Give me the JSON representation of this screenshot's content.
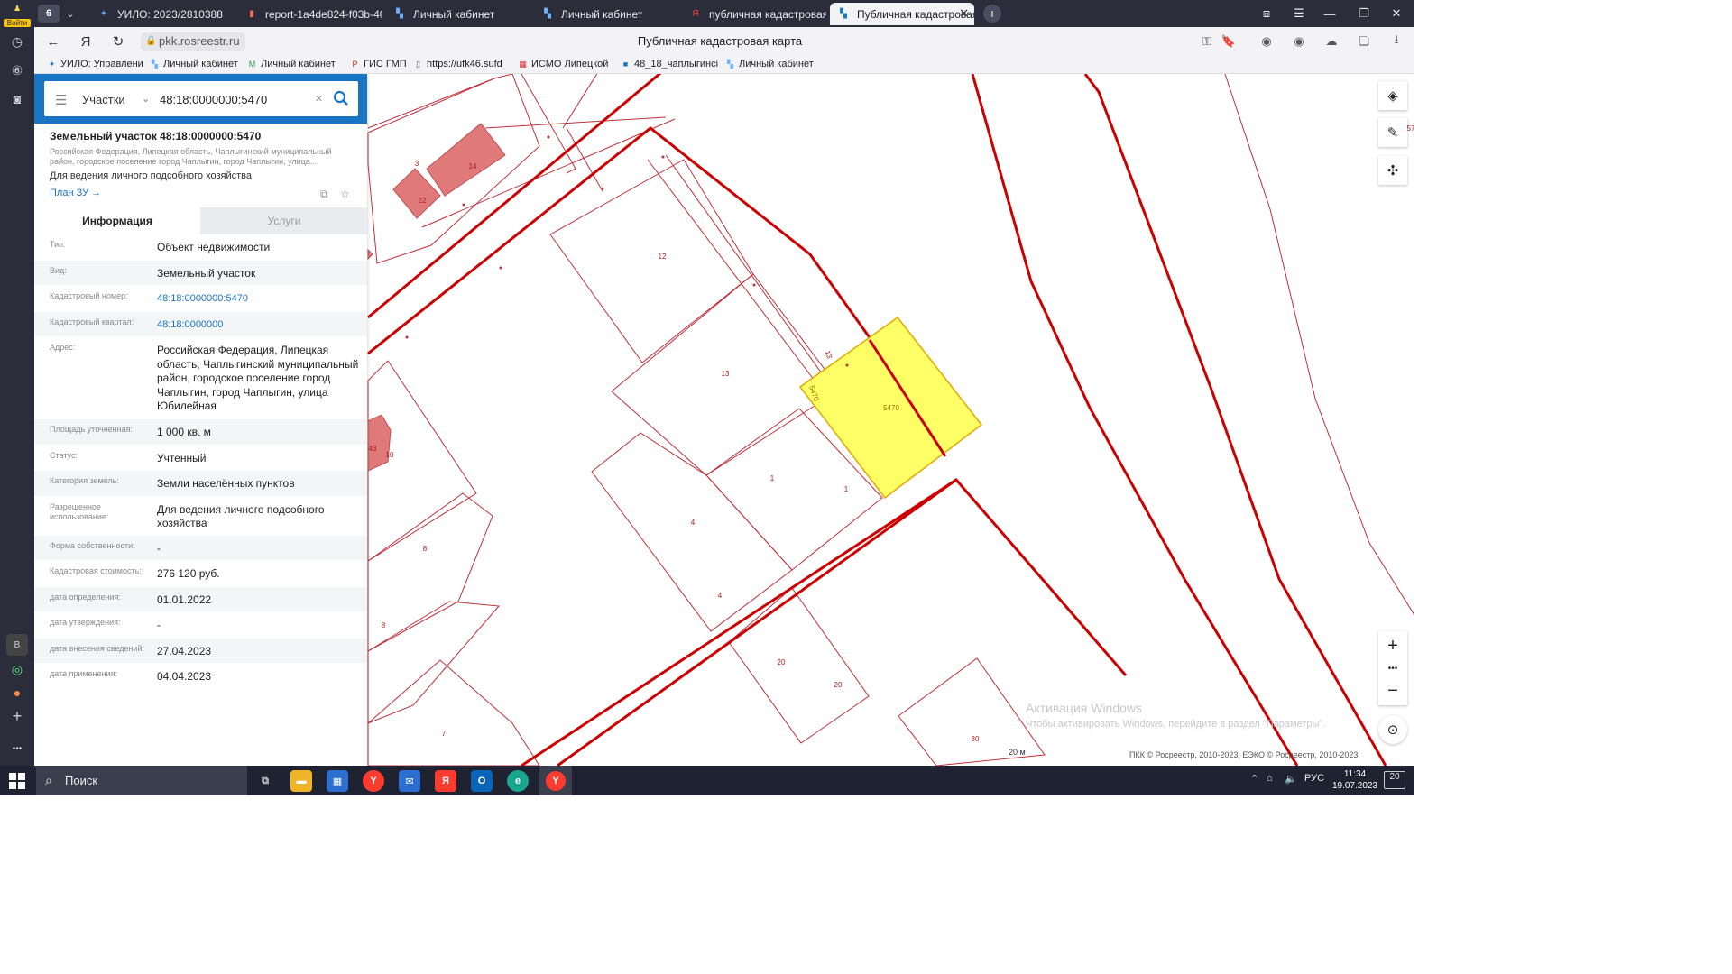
{
  "browser": {
    "tab_count": "6",
    "login_label": "Войти",
    "tabs": [
      {
        "label": "УИЛО: 2023/2810388",
        "active": false
      },
      {
        "label": "report-1a4de824-f03b-40e",
        "active": false
      },
      {
        "label": "Личный кабинет",
        "active": false
      },
      {
        "label": "Личный кабинет",
        "active": false
      },
      {
        "label": "публичная кадастровая к",
        "active": false
      },
      {
        "label": "Публичная кадастровая",
        "active": true
      }
    ],
    "url": "pkk.rosreestr.ru",
    "page_title": "Публичная кадастровая карта",
    "bookmarks": [
      "УИЛО: Управлени",
      "Личный кабинет",
      "Личный кабинет",
      "ГИС ГМП",
      "https://ufk46.sufd",
      "ИСМО Липецкой",
      "48_18_чаплыгинсі",
      "Личный кабинет"
    ],
    "sidebar_items": [
      "history-icon",
      "tabs-icon",
      "camera-icon"
    ]
  },
  "search": {
    "type_label": "Участки",
    "query": "48:18:0000000:5470"
  },
  "object": {
    "title": "Земельный участок 48:18:0000000:5470",
    "address_short": "Российская Федерация, Липецкая область, Чаплыгинский муниципальный район, городское поселение город Чаплыгин, город Чаплыгин, улица...",
    "use": "Для ведения личного подсобного хозяйства",
    "plan_link": "План ЗУ →"
  },
  "panel_tabs": [
    "Информация",
    "Услуги"
  ],
  "info_rows": [
    {
      "key": "Тип:",
      "value": "Объект недвижимости"
    },
    {
      "key": "Вид:",
      "value": "Земельный участок"
    },
    {
      "key": "Кадастровый номер:",
      "value": "48:18:0000000:5470",
      "link": true
    },
    {
      "key": "Кадастровый квартал:",
      "value": "48:18:0000000",
      "link": true
    },
    {
      "key": "Адрес:",
      "value": "Российская Федерация, Липецкая область, Чаплыгинский муниципальный район, городское поселение город Чаплыгин, город Чаплыгин, улица Юбилейная"
    },
    {
      "key": "Площадь уточненная:",
      "value": "1 000 кв. м"
    },
    {
      "key": "Статус:",
      "value": "Учтенный"
    },
    {
      "key": "Категория земель:",
      "value": "Земли населённых пунктов"
    },
    {
      "key": "Разрешенное использование:",
      "value": "Для ведения личного подсобного хозяйства"
    },
    {
      "key": "Форма собственности:",
      "value": "-"
    },
    {
      "key": "Кадастровая стоимость:",
      "value": "276 120 руб."
    },
    {
      "key": "дата определения:",
      "value": "01.01.2022"
    },
    {
      "key": "дата утверждения:",
      "value": "-"
    },
    {
      "key": "дата внесения сведений:",
      "value": "27.04.2023"
    },
    {
      "key": "дата применения:",
      "value": "04.04.2023"
    }
  ],
  "map": {
    "parcel_labels": [
      "3",
      "14",
      "22",
      "12",
      "13",
      "13",
      "5470",
      "5470",
      "1",
      "1",
      "4",
      "4",
      "20",
      "20",
      "8",
      "8",
      "7",
      "43",
      "10",
      "30",
      "57"
    ],
    "scale": "20 м",
    "copyright": "ПКК © Росреестр, 2010-2023, ЕЭКО © Росреестр, 2010-2023",
    "watermark_title": "Активация Windows",
    "watermark_sub": "Чтобы активировать Windows, перейдите в раздел \"Параметры\".",
    "highlight_color": "#ffff66",
    "boundary_color": "#cc0000"
  },
  "taskbar": {
    "search_label": "Поиск",
    "lang": "РУС",
    "time": "11:34",
    "date": "19.07.2023",
    "notifications": "20"
  }
}
